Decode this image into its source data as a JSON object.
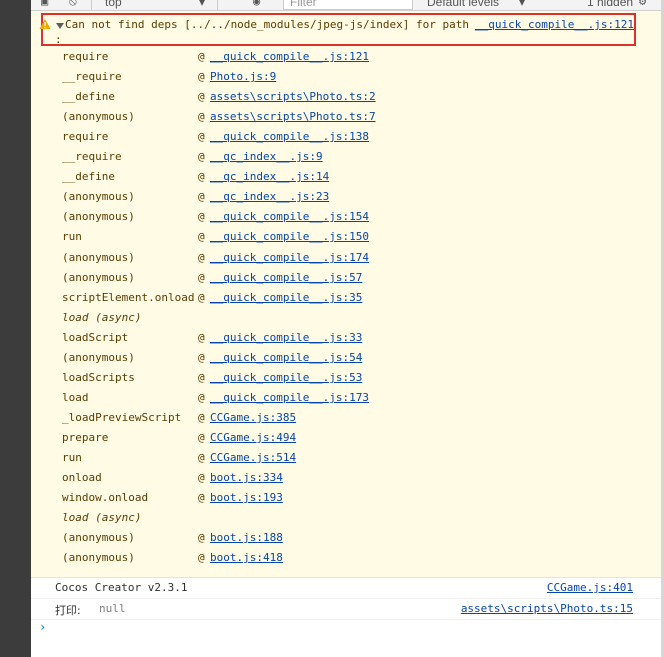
{
  "toolbar": {
    "context": "top",
    "filter_placeholder": "Filter",
    "levels": "Default levels",
    "hidden_count": "1 hidden"
  },
  "warning": {
    "message": "Can not find deps [../../node_modules/jpeg-js/index] for path ",
    "message_cont": ":",
    "source": "__quick_compile__.js:121",
    "stack": [
      {
        "fn": "require",
        "loc": "__quick_compile__.js:121"
      },
      {
        "fn": "__require",
        "loc": "Photo.js:9"
      },
      {
        "fn": "__define",
        "loc": "assets\\scripts\\Photo.ts:2"
      },
      {
        "fn": "(anonymous)",
        "loc": "assets\\scripts\\Photo.ts:7"
      },
      {
        "fn": "require",
        "loc": "__quick_compile__.js:138"
      },
      {
        "fn": "__require",
        "loc": "__qc_index__.js:9"
      },
      {
        "fn": "__define",
        "loc": "__qc_index__.js:14"
      },
      {
        "fn": "(anonymous)",
        "loc": "__qc_index__.js:23"
      },
      {
        "fn": "(anonymous)",
        "loc": "__quick_compile__.js:154"
      },
      {
        "fn": "run",
        "loc": "__quick_compile__.js:150"
      },
      {
        "fn": "(anonymous)",
        "loc": "__quick_compile__.js:174"
      },
      {
        "fn": "(anonymous)",
        "loc": "__quick_compile__.js:57"
      },
      {
        "fn": "scriptElement.onload",
        "loc": "__quick_compile__.js:35"
      },
      {
        "async": "load (async)"
      },
      {
        "fn": "loadScript",
        "loc": "__quick_compile__.js:33"
      },
      {
        "fn": "(anonymous)",
        "loc": "__quick_compile__.js:54"
      },
      {
        "fn": "loadScripts",
        "loc": "__quick_compile__.js:53"
      },
      {
        "fn": "load",
        "loc": "__quick_compile__.js:173"
      },
      {
        "fn": "_loadPreviewScript",
        "loc": "CCGame.js:385"
      },
      {
        "fn": "prepare",
        "loc": "CCGame.js:494"
      },
      {
        "fn": "run",
        "loc": "CCGame.js:514"
      },
      {
        "fn": "onload",
        "loc": "boot.js:334"
      },
      {
        "fn": "window.onload",
        "loc": "boot.js:193"
      },
      {
        "async": "load (async)"
      },
      {
        "fn": "(anonymous)",
        "loc": "boot.js:188"
      },
      {
        "fn": "(anonymous)",
        "loc": "boot.js:418"
      }
    ]
  },
  "logs": [
    {
      "text": "Cocos Creator v2.3.1",
      "source": "CCGame.js:401"
    },
    {
      "key": "打印:",
      "value": "null",
      "source": "assets\\scripts\\Photo.ts:15"
    }
  ],
  "prompt_symbol": "›",
  "colors": {
    "warning_bg": "#fffbe5",
    "highlight": "#e0302b",
    "link": "#0645ad"
  }
}
